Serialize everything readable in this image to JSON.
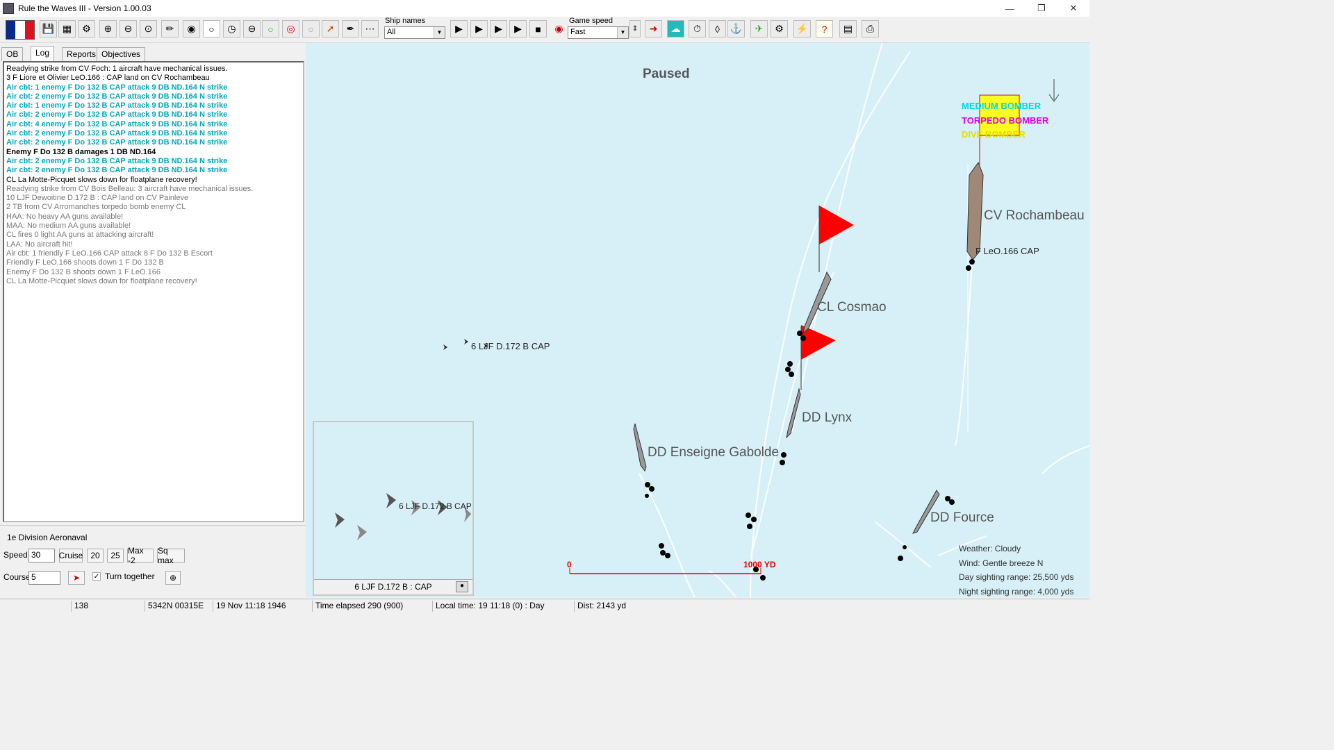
{
  "window": {
    "title": "Rule the Waves III - Version 1.00.03"
  },
  "toolbar": {
    "ship_names_label": "Ship names",
    "ship_names_value": "All",
    "game_speed_label": "Game speed",
    "game_speed_value": "Fast"
  },
  "tabs": [
    "OB",
    "Log",
    "Reports",
    "Objectives"
  ],
  "log": [
    {
      "text": "Readying strike from CV Foch: 1 aircraft have mechanical issues.",
      "style": "normal"
    },
    {
      "text": "3 F Liore et Olivier LeO.166 : CAP land on CV Rochambeau",
      "style": "normal"
    },
    {
      "text": "Air cbt: 1  enemy F Do 132 B CAP attack 9 DB ND.164 N strike",
      "style": "cyan"
    },
    {
      "text": "Air cbt: 2  enemy F Do 132 B CAP attack 9 DB ND.164 N strike",
      "style": "cyan"
    },
    {
      "text": "Air cbt: 1  enemy F Do 132 B CAP attack 9 DB ND.164 N strike",
      "style": "cyan"
    },
    {
      "text": "Air cbt: 2  enemy F Do 132 B CAP attack 9 DB ND.164 N strike",
      "style": "cyan"
    },
    {
      "text": "Air cbt: 4  enemy F Do 132 B CAP attack 9 DB ND.164 N strike",
      "style": "cyan"
    },
    {
      "text": "Air cbt: 2  enemy F Do 132 B CAP attack 9 DB ND.164 N strike",
      "style": "cyan"
    },
    {
      "text": "Air cbt: 2  enemy F Do 132 B CAP attack 9 DB ND.164 N strike",
      "style": "cyan"
    },
    {
      "text": " Enemy F Do 132 B damages 1 DB ND.164",
      "style": "bold"
    },
    {
      "text": "Air cbt: 2  enemy F Do 132 B CAP attack 9 DB ND.164 N strike",
      "style": "cyan"
    },
    {
      "text": "Air cbt: 2  enemy F Do 132 B CAP attack 9 DB ND.164 N strike",
      "style": "cyan"
    },
    {
      "text": "CL La Motte-Picquet slows down for floatplane recovery!",
      "style": "normal"
    },
    {
      "text": "Readying strike from CV Bois Belleau: 3 aircraft have mechanical issues.",
      "style": "gray"
    },
    {
      "text": "10 LJF Dewoitine D.172 B : CAP land on CV Painleve",
      "style": "gray"
    },
    {
      "text": "2 TB from CV Arromanches torpedo bomb enemy CL",
      "style": "gray"
    },
    {
      "text": "HAA: No heavy AA guns available!",
      "style": "gray"
    },
    {
      "text": "MAA: No medium AA guns available!",
      "style": "gray"
    },
    {
      "text": "CL fires 0 light AA guns at attacking aircraft!",
      "style": "gray"
    },
    {
      "text": "LAA: No aircraft hit!",
      "style": "gray"
    },
    {
      "text": "Air cbt: 1  friendly F LeO.166 CAP attack 8 F Do 132 B Escort",
      "style": "gray"
    },
    {
      "text": " Friendly F LeO.166 shoots down 1 F Do 132 B",
      "style": "gray"
    },
    {
      "text": " Enemy F Do 132 B shoots down 1 F LeO.166",
      "style": "gray"
    },
    {
      "text": "CL La Motte-Picquet slows down for floatplane recovery!",
      "style": "gray"
    }
  ],
  "unit_panel": {
    "title": "1e Division Aeronaval",
    "speed_label": "Speed",
    "speed_value": "30",
    "cruise_label": "Cruise",
    "b20": "20",
    "b25": "25",
    "max_label": "Max -2",
    "sqmax_label": "Sq max",
    "course_label": "Course",
    "course_value": "5",
    "turn_together_label": "Turn together"
  },
  "map": {
    "paused_label": "Paused",
    "ships": [
      {
        "name": "CV Rochambeau"
      },
      {
        "name": "CL Cosmao"
      },
      {
        "name": "DD Lynx"
      },
      {
        "name": "DD Enseigne Gabolde"
      },
      {
        "name": "DD Fource"
      }
    ],
    "air_labels": {
      "leo_cap": "F LeO.166 CAP",
      "ljf_cap": "6 LJF D.172 B CAP"
    },
    "legend": {
      "medium": "MEDIUM BOMBER",
      "torpedo": "TORPEDO BOMBER",
      "dive": "DIVE BOMBER",
      "medium_color": "#00d8e8",
      "torpedo_color": "#e000e0",
      "dive_color": "#e0e000"
    },
    "scale": {
      "zero": "0",
      "end": "1000 YD",
      "color": "#e00000"
    },
    "weather": {
      "weather": "Weather: Cloudy",
      "wind": "Wind: Gentle breeze  N",
      "day_range": "Day sighting range: 25,500 yds",
      "night_range": "Night sighting range: 4,000 yds"
    }
  },
  "minimap": {
    "label": "6 LJF D.172 B : CAP",
    "overlay_label": "6 LJF D.172 B CAP"
  },
  "status": {
    "s1": "138",
    "s2": "5342N 00315E",
    "s3": "19 Nov 11:18 1946",
    "s4": "Time elapsed 290 (900)",
    "s5": "Local time: 19 11:18 (0) : Day",
    "s6": "Dist: 2143 yd"
  },
  "colors": {
    "sea": "#d7f0f7",
    "flag_red": "#ff0000",
    "hull": "#8a7060"
  }
}
